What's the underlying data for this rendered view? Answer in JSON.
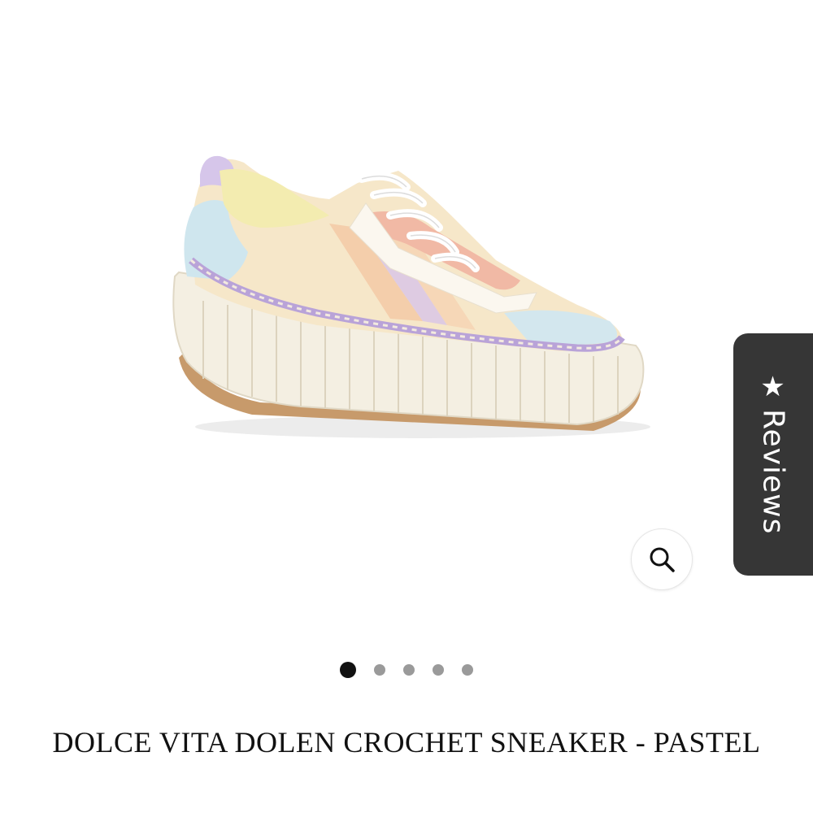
{
  "product": {
    "title": "DOLCE VITA DOLEN CROCHET SNEAKER - PASTEL",
    "image_icon": "sneaker-illustration"
  },
  "zoom": {
    "icon": "search-icon"
  },
  "reviews_tab": {
    "label": "Reviews",
    "icon": "star-icon"
  },
  "carousel": {
    "total": 5,
    "active_index": 0
  },
  "colors": {
    "reviews_tab_bg": "#363636",
    "dot_active": "#111111",
    "dot_inactive": "#9a9a9a"
  }
}
